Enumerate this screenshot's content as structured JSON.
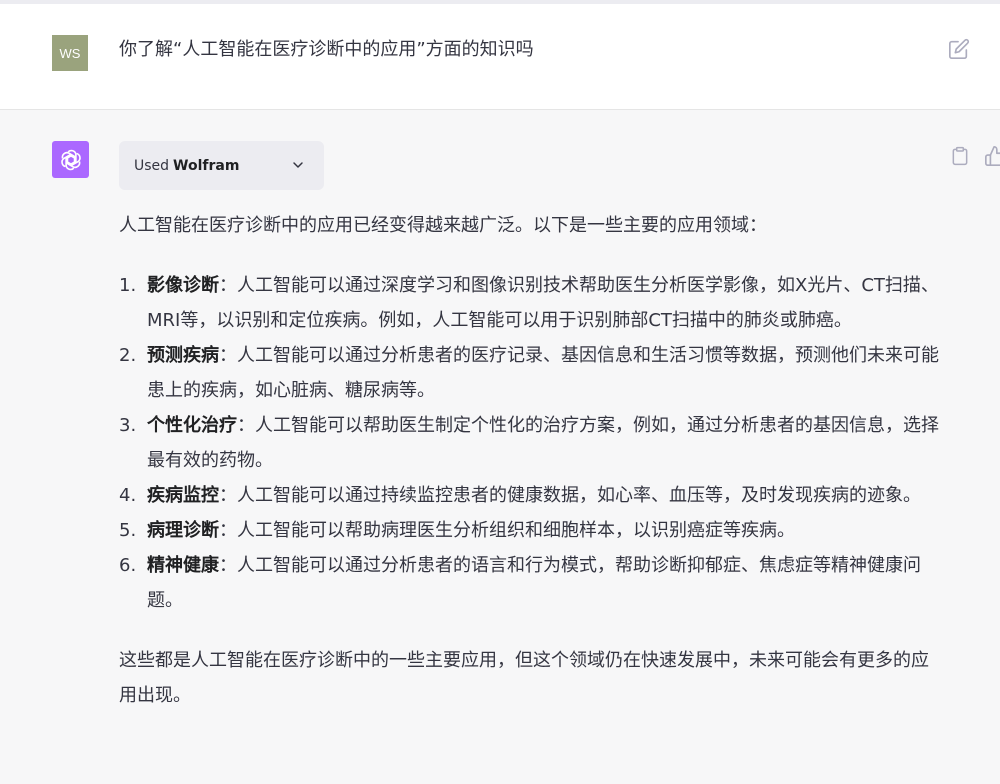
{
  "user": {
    "avatar_initials": "WS",
    "message": "你了解“人工智能在医疗诊断中的应用”方面的知识吗"
  },
  "assistant": {
    "plugin": {
      "used_label": "Used",
      "plugin_name": "Wolfram"
    },
    "intro": "人工智能在医疗诊断中的应用已经变得越来越广泛。以下是一些主要的应用领域：",
    "items": [
      {
        "num": "1.",
        "title": "影像诊断",
        "sep": "：",
        "text": "人工智能可以通过深度学习和图像识别技术帮助医生分析医学影像，如X光片、CT扫描、MRI等，以识别和定位疾病。例如，人工智能可以用于识别肺部CT扫描中的肺炎或肺癌。"
      },
      {
        "num": "2.",
        "title": "预测疾病",
        "sep": "：",
        "text": "人工智能可以通过分析患者的医疗记录、基因信息和生活习惯等数据，预测他们未来可能患上的疾病，如心脏病、糖尿病等。"
      },
      {
        "num": "3.",
        "title": "个性化治疗",
        "sep": "：",
        "text": "人工智能可以帮助医生制定个性化的治疗方案，例如，通过分析患者的基因信息，选择最有效的药物。"
      },
      {
        "num": "4.",
        "title": "疾病监控",
        "sep": "：",
        "text": "人工智能可以通过持续监控患者的健康数据，如心率、血压等，及时发现疾病的迹象。"
      },
      {
        "num": "5.",
        "title": "病理诊断",
        "sep": "：",
        "text": "人工智能可以帮助病理医生分析组织和细胞样本，以识别癌症等疾病。"
      },
      {
        "num": "6.",
        "title": "精神健康",
        "sep": "：",
        "text": "人工智能可以通过分析患者的语言和行为模式，帮助诊断抑郁症、焦虑症等精神健康问题。"
      }
    ],
    "outro": "这些都是人工智能在医疗诊断中的一些主要应用，但这个领域仍在快速发展中，未来可能会有更多的应用出现。"
  },
  "colors": {
    "user_avatar_bg": "#9aa37d",
    "assistant_avatar_bg": "#ab68ff",
    "assistant_row_bg": "#f7f7f8",
    "pill_bg": "#ececf1"
  },
  "icons": {
    "edit": "edit-icon",
    "assistant_logo": "openai-logo-icon",
    "chevron": "chevron-down-icon",
    "copy": "clipboard-icon",
    "like": "thumbs-up-icon"
  }
}
